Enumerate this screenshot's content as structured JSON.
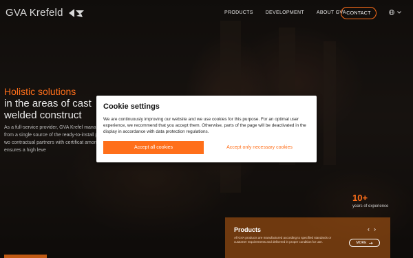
{
  "header": {
    "logo_text": "GVA Krefeld",
    "nav": [
      "PRODUCTS",
      "DEVELOPMENT",
      "ABOUT GVA"
    ],
    "contact_label": "CONTACT",
    "lang_icon": "globe-icon"
  },
  "hero": {
    "title_line1": "Holistic solutions",
    "title_line2": "in the areas of cast",
    "title_line3": "welded construct",
    "body": "As a full-service provider, GVA Krefel management from a single source of the ready-to-install part. Our wo contractual partners with certificat among others, ensures a high leve"
  },
  "stats": {
    "value": "10+",
    "label": "years of experience"
  },
  "products_card": {
    "title": "Products",
    "description": "All GVA products are manufactured according to specified standards or customer requirements and delivered in proper condition for use.",
    "more_label": "MORE"
  },
  "cookie_modal": {
    "title": "Cookie settings",
    "text": "We are continuously improving our website and we use cookies for this purpose. For an optimal user experience, we recommend that you accept them. Otherwise, parts of the page will be deactivated in the display in accordance with data protection regulations.",
    "accept_all_label": "Accept all cookies",
    "accept_necessary_label": "Accept only necessary cookies"
  },
  "colors": {
    "accent": "#ff6f1a",
    "modal_bg": "#ffffff"
  }
}
